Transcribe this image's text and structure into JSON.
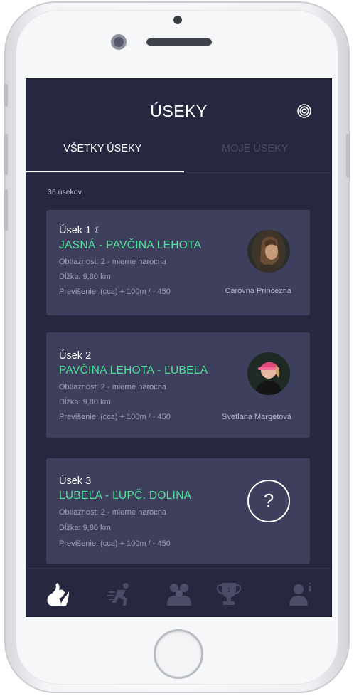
{
  "header": {
    "title": "ÚSEKY",
    "settings_icon": "target-icon"
  },
  "tabs": [
    {
      "label": "VŠETKY ÚSEKY",
      "active": true
    },
    {
      "label": "MOJE ÚSEKY",
      "active": false
    }
  ],
  "count_label": "36 úsekov",
  "sections": [
    {
      "title": "Úsek 1",
      "night_icon": "☾",
      "route": "JASNÁ - PAVČINA LEHOTA",
      "difficulty": "Obtiaznost: 2 - mierne narocna",
      "length": "Dĺžka: 9,80 km",
      "elevation": "Prevíšenie: (cca) + 100m / - 450",
      "runner": "Carovna Princezna",
      "avatar": "runner-photo"
    },
    {
      "title": "Úsek 2",
      "route": "PAVČINA LEHOTA - ĽUBEĽA",
      "difficulty": "Obtiaznost: 2 - mierne narocna",
      "length": "Dĺžka: 9,80 km",
      "elevation": "Prevíšenie: (cca) + 100m / - 450",
      "runner": "Svetlana Margetová",
      "avatar": "runner-photo"
    },
    {
      "title": "Úsek 3",
      "route": "ĽUBEĽA - ĽUPČ. DOLINA",
      "difficulty": "Obtiaznost: 2 - mierne narocna",
      "length": "Dĺžka: 9,80 km",
      "elevation": "Prevíšenie: (cca) + 100m / - 450",
      "avatar_placeholder": "?"
    }
  ],
  "bottom_nav": [
    {
      "icon": "squirrel-logo-icon",
      "active": true
    },
    {
      "icon": "runner-icon",
      "active": false
    },
    {
      "icon": "team-icon",
      "active": false
    },
    {
      "icon": "trophy-icon",
      "active": false
    },
    {
      "icon": "profile-info-icon",
      "active": false
    }
  ],
  "colors": {
    "background": "#262840",
    "card": "#3d3f5d",
    "accent_green": "#4fe29a",
    "inactive": "#4a4c68"
  }
}
